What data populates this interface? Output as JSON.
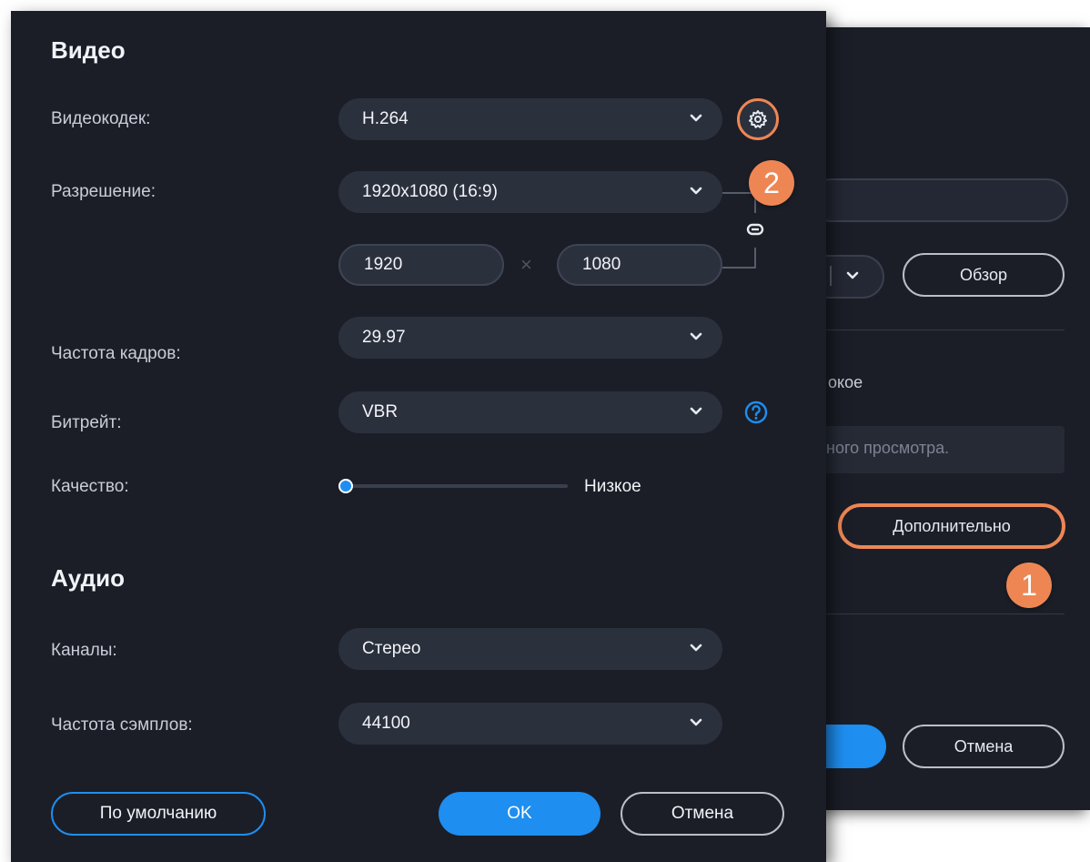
{
  "video": {
    "title": "Видео",
    "codec_label": "Видеокодек:",
    "codec_value": "H.264",
    "resolution_label": "Разрешение:",
    "resolution_value": "1920x1080 (16:9)",
    "width_value": "1920",
    "times_sign": "×",
    "height_value": "1080",
    "framerate_label": "Частота кадров:",
    "framerate_value": "29.97",
    "bitrate_label": "Битрейт:",
    "bitrate_value": "VBR",
    "quality_label": "Качество:",
    "quality_value": "Низкое",
    "quality_level": 0
  },
  "audio": {
    "title": "Аудио",
    "channels_label": "Каналы:",
    "channels_value": "Стерео",
    "samplerate_label": "Частота сэмплов:",
    "samplerate_value": "44100"
  },
  "footer": {
    "default_label": "По умолчанию",
    "ok_label": "OK",
    "cancel_label": "Отмена"
  },
  "background_dialog": {
    "browse_label": "Обзор",
    "quality_partial": "окое",
    "hint_partial": "ного просмотра.",
    "advanced_label": "Дополнительно",
    "cancel_label": "Отмена"
  },
  "callouts": {
    "step1": "1",
    "step2": "2"
  },
  "icons": {
    "settings": "gear-icon",
    "link": "link-icon",
    "help": "help-icon",
    "dropdown": "chevron-down-icon"
  },
  "colors": {
    "dialog_bg": "#1b1e27",
    "field_bg": "#2b303d",
    "accent_blue": "#1e8ef0",
    "callout_orange": "#ee8654"
  }
}
